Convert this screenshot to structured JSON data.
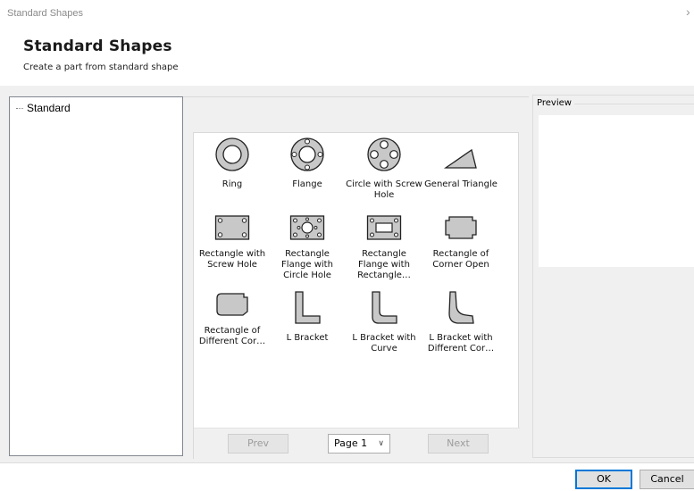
{
  "window": {
    "title": "Standard Shapes",
    "close_glyph": "›"
  },
  "header": {
    "title": "Standard Shapes",
    "subtitle": "Create a part from standard shape"
  },
  "tree": {
    "items": [
      {
        "label": "Standard"
      }
    ]
  },
  "shapes": [
    {
      "label": "Ring",
      "icon": "ring-icon"
    },
    {
      "label": "Flange",
      "icon": "flange-icon"
    },
    {
      "label": "Circle with Screw Hole",
      "icon": "circle-screw-hole-icon"
    },
    {
      "label": "General Triangle",
      "icon": "triangle-icon"
    },
    {
      "label": "Rectangle with Screw Hole",
      "icon": "rectangle-screw-hole-icon"
    },
    {
      "label": "Rectangle Flange with Circle Hole",
      "icon": "rectangle-flange-circle-icon"
    },
    {
      "label": "Rectangle Flange with Rectangle…",
      "icon": "rectangle-flange-rectangle-icon"
    },
    {
      "label": "Rectangle of Corner Open",
      "icon": "rectangle-corner-open-icon"
    },
    {
      "label": "Rectangle of Different Cor…",
      "icon": "rectangle-different-corner-icon"
    },
    {
      "label": "L Bracket",
      "icon": "l-bracket-icon"
    },
    {
      "label": "L Bracket with Curve",
      "icon": "l-bracket-curve-icon"
    },
    {
      "label": "L Bracket with Different Cor…",
      "icon": "l-bracket-different-corner-icon"
    }
  ],
  "pager": {
    "prev_label": "Prev",
    "page_label": "Page 1",
    "next_label": "Next",
    "chevron": "∨"
  },
  "preview": {
    "label": "Preview"
  },
  "buttons": {
    "ok_label": "OK",
    "cancel_label": "Cancel"
  },
  "colors": {
    "shape_fill": "#c8c8c8",
    "shape_stroke": "#222222",
    "ok_border": "#0078d7",
    "disabled_text": "#9c9c9c"
  }
}
